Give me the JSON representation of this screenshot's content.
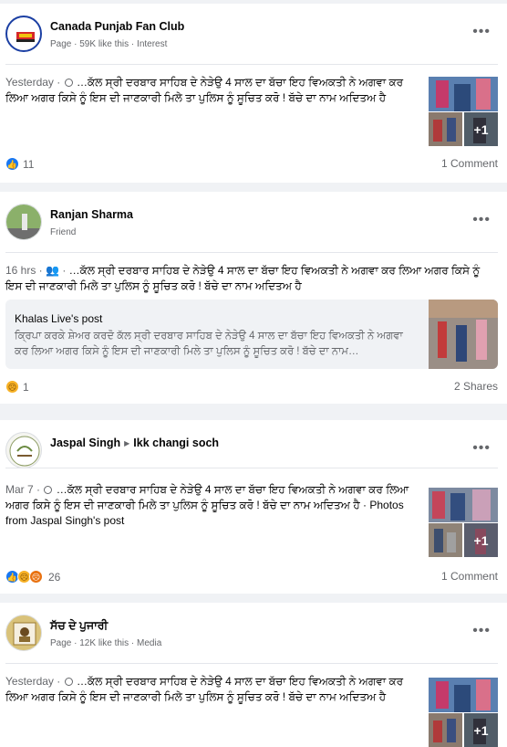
{
  "posts": [
    {
      "author": "Canada Punjab Fan Club",
      "meta": "Page · 59K like this · Interest",
      "time": "Yesterday ·",
      "text": "…ਕੱਲ ਸ੍ਰੀ ਦਰਬਾਰ ਸਾਹਿਬ ਦੇ ਨੇੜੇਉ 4 ਸਾਲ ਦਾ ਬੱਚਾ ਇਹ ਵਿਅਕਤੀ ਨੇ ਅਗਵਾ ਕਰ ਲਿਆ ਅਗਰ ਕਿਸੇ ਨੂੰ ਇਸ ਦੀ ਜਾਣਕਾਰੀ ਮਿਲੇ ਤਾ ਪੁਲਿਸ ਨੂੰ ਸੂਚਿਤ ਕਰੋ ! ਬੱਚੇ ਦਾ ਨਾਮ ਅਦਿਤਅ ਹੈ",
      "photos_more": "+1",
      "reaction_count": "11",
      "right_count": "1 Comment"
    },
    {
      "author": "Ranjan Sharma",
      "meta": "Friend",
      "time": "16 hrs ·",
      "text": "…ਕੱਲ ਸ੍ਰੀ ਦਰਬਾਰ ਸਾਹਿਬ ਦੇ ਨੇੜੇਉ 4 ਸਾਲ ਦਾ ਬੱਚਾ ਇਹ ਵਿਅਕਤੀ ਨੇ ਅਗਵਾ ਕਰ ਲਿਆ ਅਗਰ ਕਿਸੇ ਨੂੰ ਇਸ ਦੀ ਜਾਣਕਾਰੀ ਮਿਲੇ ਤਾ ਪੁਲਿਸ ਨੂੰ ਸੂਚਿਤ ਕਰੋ ! ਬੱਚੇ ਦਾ ਨਾਮ ਅਦਿਤਅ ਹੈ",
      "shared_source": "Khalas Live's post",
      "shared_text": "ਕ੍ਰਿਪਾ ਕਰਕੇ ਸ਼ੇਅਰ ਕਰਦੋ ਕੱਲ ਸ੍ਰੀ ਦਰਬਾਰ ਸਾਹਿਬ ਦੇ ਨੇੜੇਉ 4 ਸਾਲ ਦਾ ਬੱਚਾ ਇਹ ਵਿਅਕਤੀ ਨੇ ਅਗਵਾ ਕਰ ਲਿਆ ਅਗਰ ਕਿਸੇ ਨੂੰ ਇਸ ਦੀ ਜਾਣਕਾਰੀ ਮਿਲੇ ਤਾ ਪੁਲਿਸ ਨੂੰ ਸੂਚਿਤ ਕਰੋ ! ਬੱਚੇ ਦਾ ਨਾਮ…",
      "reaction_count": "1",
      "right_count": "2 Shares"
    },
    {
      "author": "Jaspal Singh",
      "target": "Ikk changi soch",
      "time": "Mar 7 ·",
      "text": "…ਕੱਲ ਸ੍ਰੀ ਦਰਬਾਰ ਸਾਹਿਬ ਦੇ ਨੇੜੇਉ 4 ਸਾਲ ਦਾ ਬੱਚਾ ਇਹ ਵਿਅਕਤੀ ਨੇ ਅਗਵਾ ਕਰ ਲਿਆ ਅਗਰ ਕਿਸੇ ਨੂੰ ਇਸ ਦੀ ਜਾਣਕਾਰੀ ਮਿਲੇ ਤਾ ਪੁਲਿਸ ਨੂੰ ਸੂਚਿਤ ਕਰੋ ! ਬੱਚੇ ਦਾ ਨਾਮ ਅਦਿਤਅ ਹੈ · Photos from Jaspal Singh's post",
      "photos_more": "+1",
      "reaction_count": "26",
      "right_count": "1 Comment"
    },
    {
      "author": "ਸੱਚ ਦੇ ਪੁਜਾਰੀ",
      "meta": "Page · 12K like this · Media",
      "time": "Yesterday ·",
      "text": "…ਕੱਲ ਸ੍ਰੀ ਦਰਬਾਰ ਸਾਹਿਬ ਦੇ ਨੇੜੇਉ 4 ਸਾਲ ਦਾ ਬੱਚਾ ਇਹ ਵਿਅਕਤੀ ਨੇ ਅਗਵਾ ਕਰ ਲਿਆ ਅਗਰ ਕਿਸੇ ਨੂੰ ਇਸ ਦੀ ਜਾਣਕਾਰੀ ਮਿਲੇ ਤਾ ਪੁਲਿਸ ਨੂੰ ਸੂਚਿਤ ਕਰੋ ! ਬੱਚੇ ਦਾ ਨਾਮ ਅਦਿਤਅ ਹੈ",
      "photos_more": "+1"
    }
  ],
  "icons": {
    "more": "more-options-icon",
    "globe": "globe-icon",
    "friends": "friends-icon",
    "like": "like-reaction-icon",
    "sad": "sad-reaction-icon",
    "angry": "angry-reaction-icon"
  },
  "colors": {
    "accent": "#1877f2",
    "secondary_text": "#65676b",
    "background": "#f0f2f5"
  }
}
